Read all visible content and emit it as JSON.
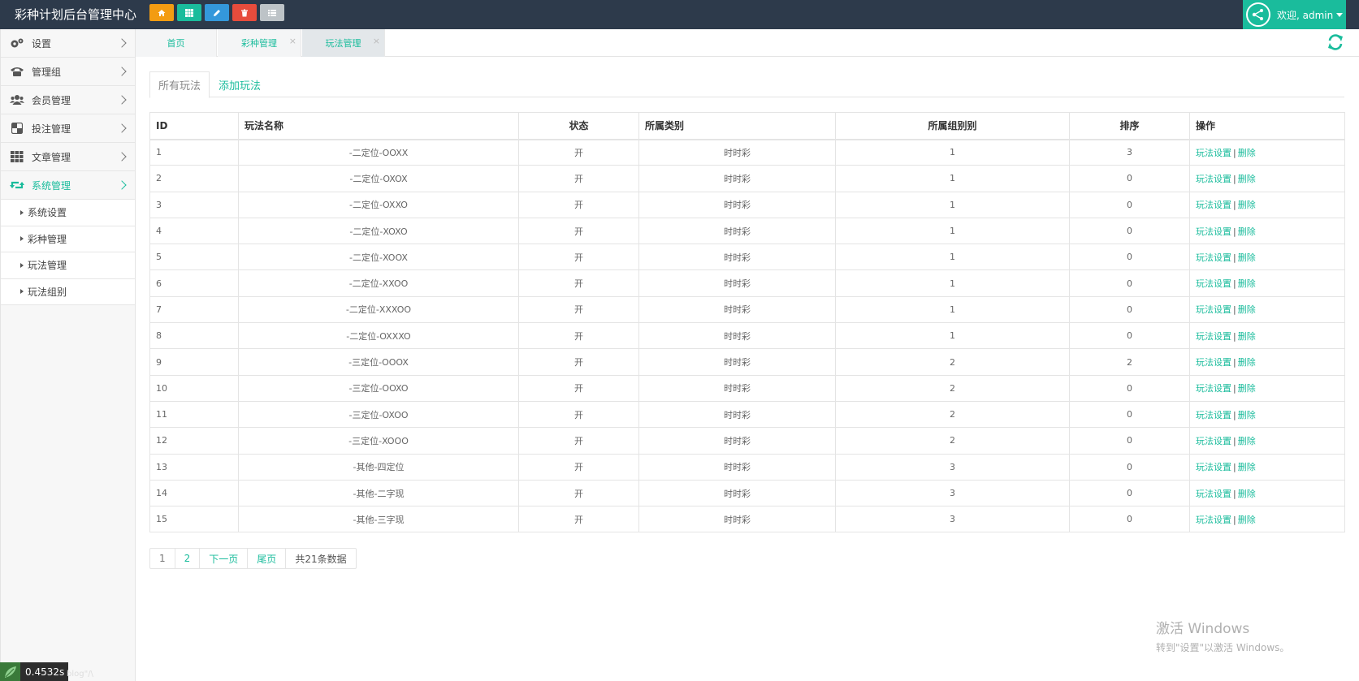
{
  "header": {
    "title": "彩种计划后台管理中心",
    "quick_buttons": [
      {
        "name": "home",
        "color": "#f39c12"
      },
      {
        "name": "grid",
        "color": "#1abc9c"
      },
      {
        "name": "edit",
        "color": "#3498db"
      },
      {
        "name": "trash",
        "color": "#e74c3c"
      },
      {
        "name": "list",
        "color": "#bdc3c7"
      }
    ],
    "user_text": "欢迎, admin"
  },
  "sidebar": {
    "items": [
      {
        "label": "设置",
        "icon": "gears-icon"
      },
      {
        "label": "管理组",
        "icon": "phone-icon"
      },
      {
        "label": "会员管理",
        "icon": "users-icon"
      },
      {
        "label": "投注管理",
        "icon": "checker-icon"
      },
      {
        "label": "文章管理",
        "icon": "th-icon"
      },
      {
        "label": "系统管理",
        "icon": "retweet-icon",
        "active": true
      }
    ],
    "sub_items": [
      {
        "label": "系统设置"
      },
      {
        "label": "彩种管理"
      },
      {
        "label": "玩法管理"
      },
      {
        "label": "玩法组别"
      }
    ]
  },
  "tabs": [
    {
      "label": "首页"
    },
    {
      "label": "彩种管理",
      "close": "×"
    },
    {
      "label": "玩法管理",
      "close": "×"
    }
  ],
  "subtabs": {
    "all": "所有玩法",
    "add": "添加玩法"
  },
  "table": {
    "headers": [
      "ID",
      "玩法名称",
      "状态",
      "所属类别",
      "所属组别别",
      "排序",
      "操作"
    ],
    "rows": [
      [
        "1",
        "-二定位-OOXX",
        "开",
        "时时彩",
        "1",
        "3"
      ],
      [
        "2",
        "-二定位-OXOX",
        "开",
        "时时彩",
        "1",
        "0"
      ],
      [
        "3",
        "-二定位-OXXO",
        "开",
        "时时彩",
        "1",
        "0"
      ],
      [
        "4",
        "-二定位-XOXO",
        "开",
        "时时彩",
        "1",
        "0"
      ],
      [
        "5",
        "-二定位-XOOX",
        "开",
        "时时彩",
        "1",
        "0"
      ],
      [
        "6",
        "-二定位-XXOO",
        "开",
        "时时彩",
        "1",
        "0"
      ],
      [
        "7",
        "-二定位-XXXOO",
        "开",
        "时时彩",
        "1",
        "0"
      ],
      [
        "8",
        "-二定位-OXXXO",
        "开",
        "时时彩",
        "1",
        "0"
      ],
      [
        "9",
        "-三定位-OOOX",
        "开",
        "时时彩",
        "2",
        "2"
      ],
      [
        "10",
        "-三定位-OOXO",
        "开",
        "时时彩",
        "2",
        "0"
      ],
      [
        "11",
        "-三定位-OXOO",
        "开",
        "时时彩",
        "2",
        "0"
      ],
      [
        "12",
        "-三定位-XOOO",
        "开",
        "时时彩",
        "2",
        "0"
      ],
      [
        "13",
        "-其他-四定位",
        "开",
        "时时彩",
        "3",
        "0"
      ],
      [
        "14",
        "-其他-二字现",
        "开",
        "时时彩",
        "3",
        "0"
      ],
      [
        "15",
        "-其他-三字现",
        "开",
        "时时彩",
        "3",
        "0"
      ]
    ],
    "op_settings": "玩法设置",
    "op_sep": "|",
    "op_delete": "删除"
  },
  "pagination": {
    "pages": [
      "1",
      "2"
    ],
    "next": "下一页",
    "last": "尾页",
    "total": "共21条数据"
  },
  "speed": "0.4532s",
  "ghost_text": "blog\"/\\",
  "watermark": {
    "line1": "激活 Windows",
    "line2": "转到\"设置\"以激活 Windows。"
  },
  "colors": {
    "accent": "#1abc9c",
    "header_bg": "#2d3a4b"
  }
}
